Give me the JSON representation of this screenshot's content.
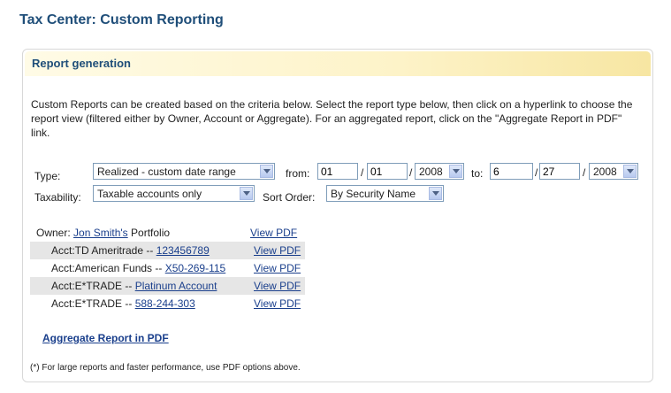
{
  "page_title": "Tax Center: Custom Reporting",
  "panel": {
    "title": "Report generation",
    "intro": "Custom Reports can be created based on the criteria below. Select the report type below, then click on a hyperlink to choose the report view (filtered either by Owner, Account or Aggregate). For an aggregated report, click on the \"Aggregate Report in PDF\" link."
  },
  "filters": {
    "type_label": "Type:",
    "type_value": "Realized - custom date range",
    "from_label": "from:",
    "from_month": "01",
    "from_day": "01",
    "from_year": "2008",
    "to_label": "to:",
    "to_month": "6",
    "to_day": "27",
    "to_year": "2008",
    "slash": "/",
    "taxability_label": "Taxability:",
    "taxability_value": "Taxable accounts only",
    "sort_label": "Sort Order:",
    "sort_value": "By Security Name"
  },
  "owner": {
    "prefix": "Owner:",
    "name": "Jon Smith's",
    "suffix": "Portfolio",
    "pdf": "View PDF"
  },
  "accounts": [
    {
      "prefix": "Acct:TD Ameritrade --",
      "link": "123456789",
      "pdf": "View PDF"
    },
    {
      "prefix": "Acct:American Funds --",
      "link": "X50-269-115",
      "pdf": "View PDF"
    },
    {
      "prefix": "Acct:E*TRADE --",
      "link": "Platinum Account",
      "pdf": "View PDF"
    },
    {
      "prefix": "Acct:E*TRADE --",
      "link": "588-244-303",
      "pdf": "View PDF"
    }
  ],
  "aggregate_link": "Aggregate Report in PDF",
  "footnote": "(*) For large reports and faster performance, use PDF options above.",
  "icons": {
    "dropdown": "chevron-down-icon"
  },
  "colors": {
    "title": "#1f4e79",
    "link": "#1a3f8c",
    "header_bg": "#fdf3c8",
    "row_shade": "#e6e6e6"
  }
}
